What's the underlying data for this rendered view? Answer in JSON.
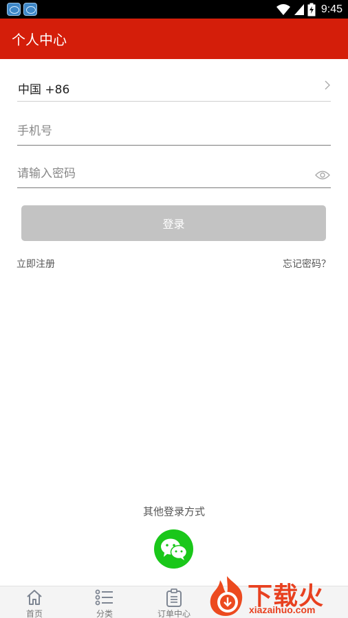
{
  "status_bar": {
    "time": "9:45",
    "icons": [
      "app-notification-icon",
      "app-notification-icon",
      "wifi-icon",
      "cellular-signal-icon",
      "battery-charging-icon"
    ]
  },
  "app_bar": {
    "title": "个人中心",
    "background_color": "#d41e0a"
  },
  "form": {
    "country_code": "中国 +86",
    "phone_placeholder": "手机号",
    "password_placeholder": "请输入密码",
    "login_label": "登录",
    "login_button_color": "#c3c3c3"
  },
  "links": {
    "register": "立即注册",
    "forgot_password": "忘记密码？"
  },
  "other_login": {
    "label": "其他登录方式",
    "wechat_color": "#1ac71a"
  },
  "bottom_nav": {
    "items": [
      {
        "label": "首页",
        "icon": "home-icon"
      },
      {
        "label": "分类",
        "icon": "list-icon"
      },
      {
        "label": "订单中心",
        "icon": "clipboard-icon"
      }
    ]
  },
  "watermark": {
    "title": "下载火",
    "url": "xiazaihuo.com",
    "color": "#e8401f"
  }
}
